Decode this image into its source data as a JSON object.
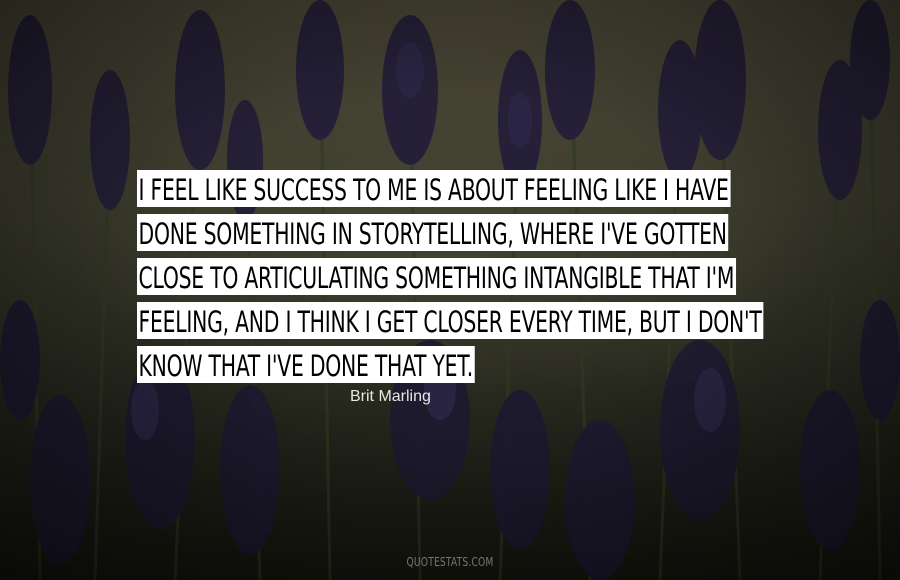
{
  "quote": {
    "lines": [
      "I FEEL LIKE SUCCESS TO ME IS ABOUT FEELING LIKE I HAVE",
      "DONE SOMETHING IN STORYTELLING, WHERE I'VE GOTTEN",
      "CLOSE TO ARTICULATING SOMETHING INTANGIBLE THAT I'M",
      "FEELING, AND I THINK I GET CLOSER EVERY TIME, BUT I DON'T",
      "KNOW THAT I'VE DONE THAT YET."
    ]
  },
  "author": "Brit Marling",
  "watermark": "QUOTESTATS.COM",
  "colors": {
    "quote_background": "#ffffff",
    "quote_text": "#000000",
    "author_text": "#e8e6e0",
    "scene_flowers": "#2a2540"
  },
  "background_description_icon": "lavender-field-photo"
}
